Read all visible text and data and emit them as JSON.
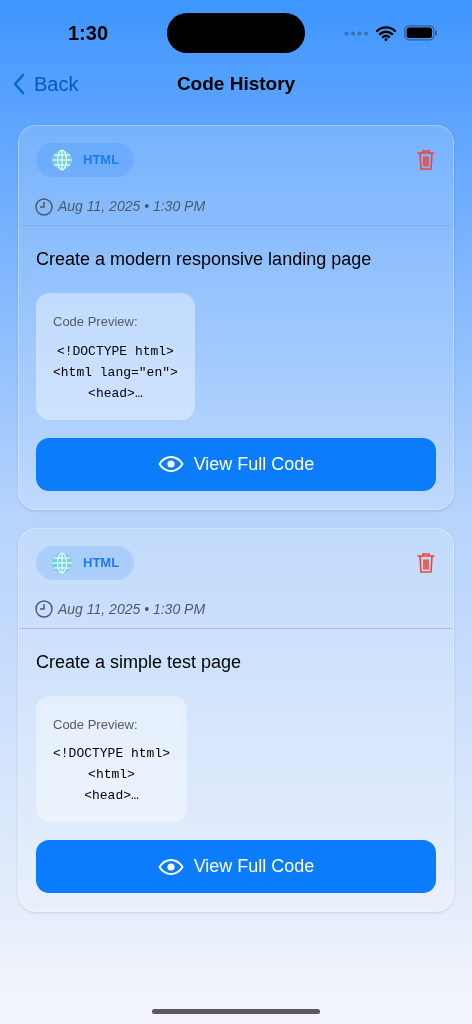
{
  "status_bar": {
    "time": "1:30"
  },
  "nav": {
    "back": "Back",
    "title": "Code History"
  },
  "entries": [
    {
      "language": "HTML",
      "date": "Aug 11, 2025 • 1:30 PM",
      "title": "Create a modern responsive landing page",
      "preview_label": "Code Preview:",
      "preview_lines": [
        "<!DOCTYPE html>",
        "<html lang=\"en\">",
        "<head>…"
      ],
      "button": "View Full Code"
    },
    {
      "language": "HTML",
      "date": "Aug 11, 2025 • 1:30 PM",
      "title": "Create a simple test page",
      "preview_label": "Code Preview:",
      "preview_lines": [
        "<!DOCTYPE html>",
        "<html>",
        "<head>…"
      ],
      "button": "View Full Code"
    }
  ]
}
